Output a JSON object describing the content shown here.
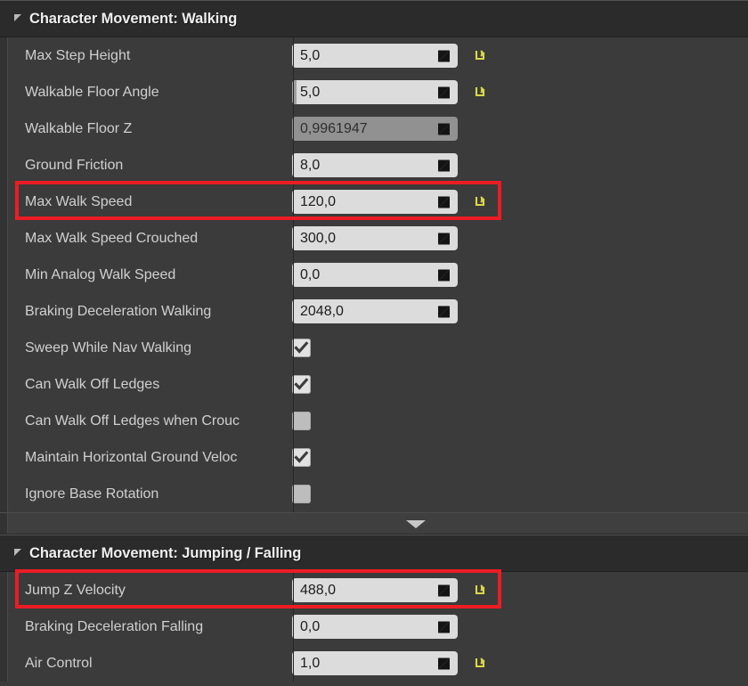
{
  "colors": {
    "panel_bg": "#3b3b3b",
    "header_bg": "#2b2b2b",
    "field_bg": "#dcdcdc",
    "field_disabled_bg": "#919191",
    "reset_icon": "#d8d84a",
    "highlight": "#ec1c24",
    "label_text": "#d0d0d0"
  },
  "sections": [
    {
      "title": "Character Movement: Walking",
      "collapse_icon": "triangle-expanded-icon",
      "rows": [
        {
          "label": "Max Step Height",
          "type": "number",
          "value": "5,0",
          "disabled": false,
          "slider_fill": false,
          "spinner": true,
          "reset": true
        },
        {
          "label": "Walkable Floor Angle",
          "type": "number",
          "value": "5,0",
          "disabled": false,
          "slider_fill": true,
          "spinner": true,
          "reset": true
        },
        {
          "label": "Walkable Floor Z",
          "type": "number",
          "value": "0,9961947",
          "disabled": true,
          "slider_fill": false,
          "spinner": true,
          "reset": false
        },
        {
          "label": "Ground Friction",
          "type": "number",
          "value": "8,0",
          "disabled": false,
          "slider_fill": false,
          "spinner": true,
          "reset": false
        },
        {
          "label": "Max Walk Speed",
          "type": "number",
          "value": "120,0",
          "disabled": false,
          "slider_fill": false,
          "spinner": true,
          "reset": true,
          "highlighted": true
        },
        {
          "label": "Max Walk Speed Crouched",
          "type": "number",
          "value": "300,0",
          "disabled": false,
          "slider_fill": false,
          "spinner": true,
          "reset": false
        },
        {
          "label": "Min Analog Walk Speed",
          "type": "number",
          "value": "0,0",
          "disabled": false,
          "slider_fill": false,
          "spinner": true,
          "reset": false
        },
        {
          "label": "Braking Deceleration Walking",
          "type": "number",
          "value": "2048,0",
          "disabled": false,
          "slider_fill": false,
          "spinner": true,
          "reset": false
        },
        {
          "label": "Sweep While Nav Walking",
          "type": "checkbox",
          "checked": true
        },
        {
          "label": "Can Walk Off Ledges",
          "type": "checkbox",
          "checked": true
        },
        {
          "label": "Can Walk Off Ledges when Crouc",
          "type": "checkbox",
          "checked": false
        },
        {
          "label": "Maintain Horizontal Ground Veloc",
          "type": "checkbox",
          "checked": true
        },
        {
          "label": "Ignore Base Rotation",
          "type": "checkbox",
          "checked": false
        }
      ]
    },
    {
      "title": "Character Movement: Jumping / Falling",
      "collapse_icon": "triangle-expanded-icon",
      "rows": [
        {
          "label": "Jump Z Velocity",
          "type": "number",
          "value": "488,0",
          "disabled": false,
          "slider_fill": false,
          "spinner": true,
          "reset": true,
          "highlighted": true
        },
        {
          "label": "Braking Deceleration Falling",
          "type": "number",
          "value": "0,0",
          "disabled": false,
          "slider_fill": false,
          "spinner": true,
          "reset": false
        },
        {
          "label": "Air Control",
          "type": "number",
          "value": "1,0",
          "disabled": false,
          "slider_fill": false,
          "spinner": true,
          "reset": true
        }
      ]
    }
  ],
  "expander": {
    "icon": "chevron-down-icon"
  }
}
